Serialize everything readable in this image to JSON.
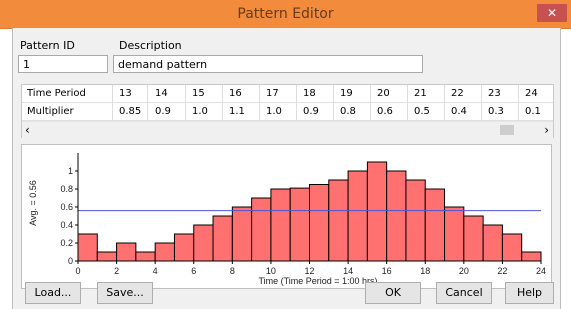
{
  "window": {
    "title": "Pattern Editor",
    "close_glyph": "✕"
  },
  "labels": {
    "pattern_id": "Pattern ID",
    "description": "Description"
  },
  "fields": {
    "pattern_id_value": "1",
    "description_value": "demand pattern"
  },
  "grid": {
    "row_headers": [
      "Time Period",
      "Multiplier"
    ],
    "periods": [
      "13",
      "14",
      "15",
      "16",
      "17",
      "18",
      "19",
      "20",
      "21",
      "22",
      "23",
      "24"
    ],
    "multipliers": [
      "0.85",
      "0.9",
      "1.0",
      "1.1",
      "1.0",
      "0.9",
      "0.8",
      "0.6",
      "0.5",
      "0.4",
      "0.3",
      "0.1"
    ]
  },
  "buttons": {
    "load": "Load...",
    "save": "Save...",
    "ok": "OK",
    "cancel": "Cancel",
    "help": "Help"
  },
  "colors": {
    "accent": "#f28c3c",
    "bar": "#ff7070",
    "avg_line": "#4a55d6"
  },
  "chart_data": {
    "type": "bar",
    "xlabel": "Time (Time Period = 1:00 hrs)",
    "ylabel": "Avg. = 0.56",
    "xlim": [
      0,
      24
    ],
    "ylim": [
      0,
      1.2
    ],
    "x_ticks": [
      "0",
      "2",
      "4",
      "6",
      "8",
      "10",
      "12",
      "14",
      "16",
      "18",
      "20",
      "22",
      "24"
    ],
    "y_ticks": [
      "0",
      "0.2",
      "0.4",
      "0.6",
      "0.8",
      "1"
    ],
    "average": 0.56,
    "values": [
      0.3,
      0.1,
      0.2,
      0.1,
      0.2,
      0.3,
      0.4,
      0.5,
      0.6,
      0.7,
      0.8,
      0.81,
      0.85,
      0.9,
      1.0,
      1.1,
      1.0,
      0.9,
      0.8,
      0.6,
      0.5,
      0.4,
      0.3,
      0.1
    ]
  }
}
